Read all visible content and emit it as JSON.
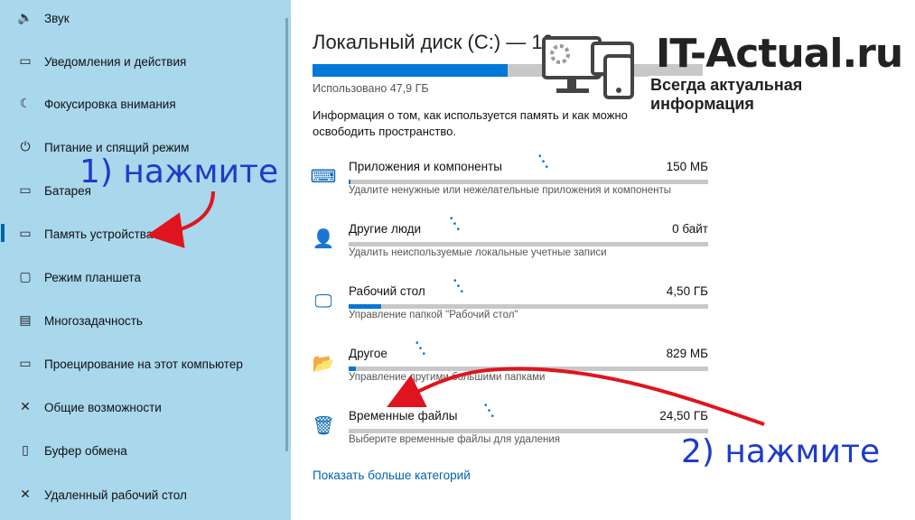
{
  "sidebar": {
    "items": [
      {
        "label": "Звук",
        "icon": "speaker-icon",
        "glyph": "🔈"
      },
      {
        "label": "Уведомления и действия",
        "icon": "notification-icon",
        "glyph": "▭"
      },
      {
        "label": "Фокусировка внимания",
        "icon": "moon-icon",
        "glyph": "☾"
      },
      {
        "label": "Питание и спящий режим",
        "icon": "power-icon",
        "glyph": "⏻"
      },
      {
        "label": "Батарея",
        "icon": "battery-icon",
        "glyph": "▭"
      },
      {
        "label": "Память устройства",
        "icon": "storage-icon",
        "glyph": "▭"
      },
      {
        "label": "Режим планшета",
        "icon": "tablet-icon",
        "glyph": "▢"
      },
      {
        "label": "Многозадачность",
        "icon": "multitask-icon",
        "glyph": "▤"
      },
      {
        "label": "Проецирование на этот компьютер",
        "icon": "projection-icon",
        "glyph": "▭"
      },
      {
        "label": "Общие возможности",
        "icon": "shared-experiences-icon",
        "glyph": "✕"
      },
      {
        "label": "Буфер обмена",
        "icon": "clipboard-icon",
        "glyph": "▯"
      },
      {
        "label": "Удаленный рабочий стол",
        "icon": "remote-desktop-icon",
        "glyph": "✕"
      }
    ],
    "active_index": 5
  },
  "main": {
    "title": "Локальный диск (C:) — 10",
    "used_fraction": 0.5,
    "used_label": "Использовано 47,9 ГБ",
    "info": "Информация о том, как используется память и как можно освободить пространство.",
    "categories": [
      {
        "name": "Приложения и компоненты",
        "size": "150 МБ",
        "desc": "Удалите ненужные или нежелательные приложения и компоненты",
        "fill": 0.005,
        "icon": "apps-icon",
        "glyph": "⌨"
      },
      {
        "name": "Другие люди",
        "size": "0 байт",
        "desc": "Удалить неиспользуемые локальные учетные записи",
        "fill": 0.0,
        "icon": "people-icon",
        "glyph": "👤"
      },
      {
        "name": "Рабочий стол",
        "size": "4,50 ГБ",
        "desc": "Управление папкой \"Рабочий стол\"",
        "fill": 0.09,
        "icon": "desktop-icon",
        "glyph": "🖵"
      },
      {
        "name": "Другое",
        "size": "829 МБ",
        "desc": "Управление другими большими папками",
        "fill": 0.02,
        "icon": "other-folder-icon",
        "glyph": "📂"
      },
      {
        "name": "Временные файлы",
        "size": "24,50 ГБ",
        "desc": "Выберите временные файлы для удаления",
        "fill": 0.0,
        "icon": "trash-icon",
        "glyph": "🗑"
      }
    ],
    "more_link": "Показать больше категорий"
  },
  "annotations": {
    "step1": "1) нажмите",
    "step2": "2) нажмите"
  },
  "logo": {
    "title": "IT-Actual.ru",
    "subtitle": "Всегда актуальная информация"
  },
  "colors": {
    "sidebar_bg": "#a9d7ec",
    "accent": "#0078d7",
    "arrow": "#e0141e",
    "annotation": "#1e3cc8"
  }
}
